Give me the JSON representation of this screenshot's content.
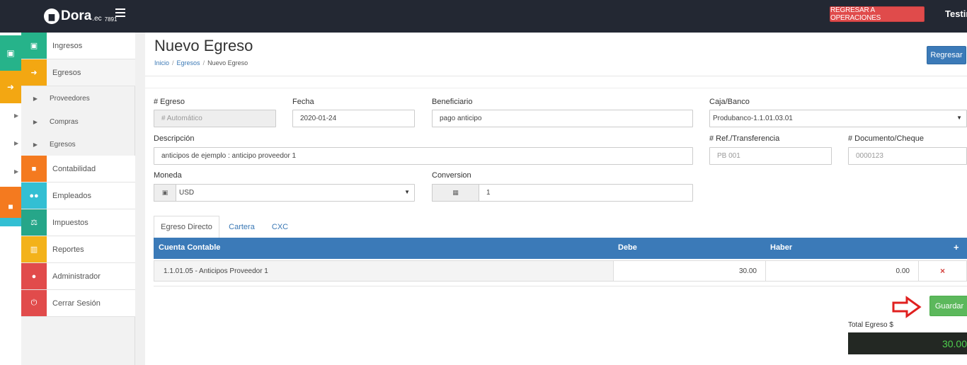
{
  "topbar": {
    "brand": "Dora",
    "brand_suffix": ".ec",
    "brand_number": "7891",
    "ops_button": "REGRESAR A OPERACIONES",
    "user": "Testin"
  },
  "sidebar": {
    "items": [
      {
        "label": "Ingresos",
        "color": "#26b38a"
      },
      {
        "label": "Egresos",
        "color": "#f3a712"
      },
      {
        "label": "Contabilidad",
        "color": "#f47a1f"
      },
      {
        "label": "Empleados",
        "color": "#33bfd3"
      },
      {
        "label": "Impuestos",
        "color": "#26a689"
      },
      {
        "label": "Reportes",
        "color": "#f3b21a"
      },
      {
        "label": "Administrador",
        "color": "#e14b4b"
      },
      {
        "label": "Cerrar Sesión",
        "color": "#e14b4b"
      }
    ],
    "subitems": [
      "Proveedores",
      "Compras",
      "Egresos"
    ]
  },
  "page": {
    "title": "Nuevo Egreso",
    "breadcrumb": [
      "Inicio",
      "Egresos",
      "Nuevo Egreso"
    ],
    "back_button": "Regresar"
  },
  "form": {
    "egreso_label": "# Egreso",
    "egreso_placeholder": "# Automático",
    "fecha_label": "Fecha",
    "fecha_value": "2020-01-24",
    "beneficiario_label": "Beneficiario",
    "beneficiario_value": "pago anticipo",
    "caja_label": "Caja/Banco",
    "caja_value": "Produbanco-1.1.01.03.01",
    "descripcion_label": "Descripción",
    "descripcion_value": "anticipos de ejemplo : anticipo proveedor 1",
    "ref_label": "# Ref./Transferencia",
    "ref_placeholder": "PB 001",
    "doc_label": "# Documento/Cheque",
    "doc_placeholder": "0000123",
    "moneda_label": "Moneda",
    "moneda_value": "USD",
    "conversion_label": "Conversion",
    "conversion_value": "1"
  },
  "tabs": [
    "Egreso Directo",
    "Cartera",
    "CXC"
  ],
  "table": {
    "headers": [
      "Cuenta Contable",
      "Debe",
      "Haber"
    ],
    "add_symbol": "+",
    "rows": [
      {
        "cuenta": "1.1.01.05 - Anticipos Proveedor 1",
        "debe": "30.00",
        "haber": "0.00",
        "delete": "×"
      }
    ]
  },
  "footer": {
    "save_button": "Guardar",
    "total_label": "Total Egreso $",
    "total_value": "30.00"
  }
}
